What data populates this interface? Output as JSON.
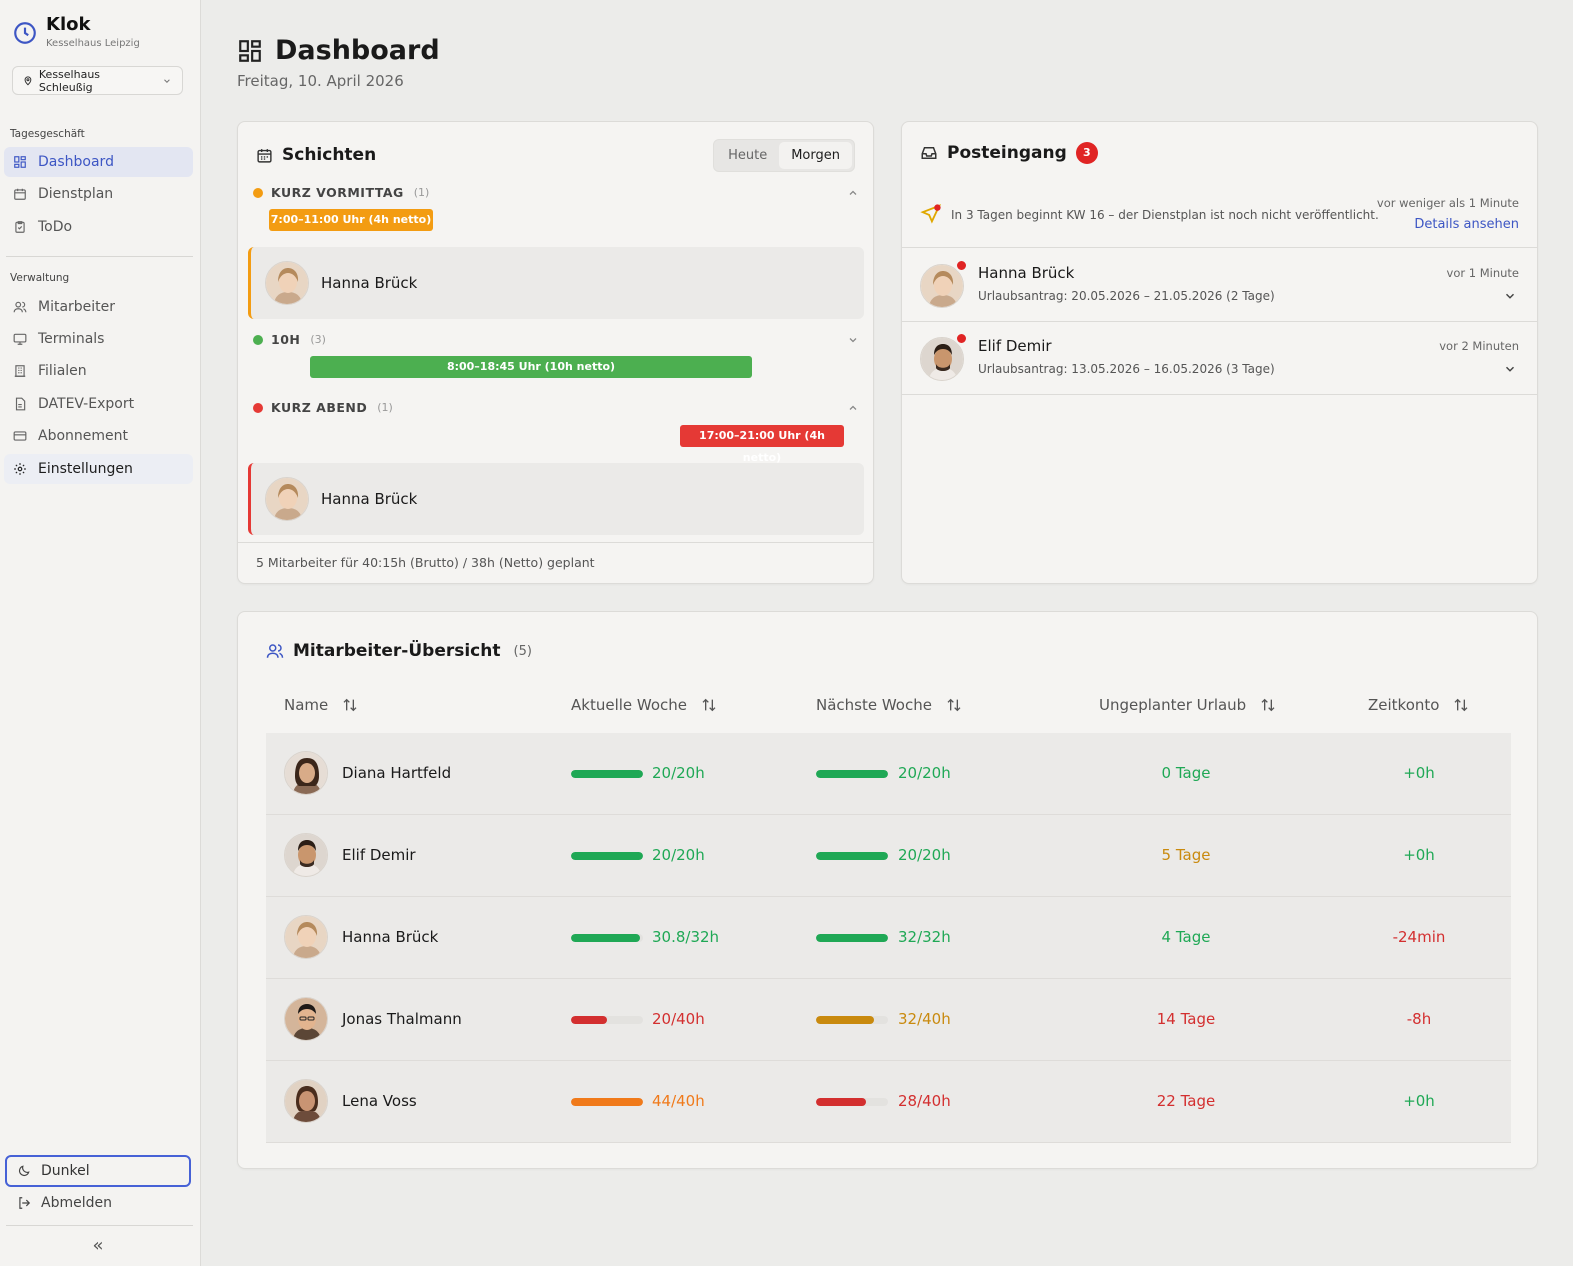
{
  "app": {
    "name": "Klok",
    "org": "Kesselhaus Leipzig"
  },
  "branch": {
    "selected": "Kesselhaus Schleußig"
  },
  "colors": {
    "accent": "#3d56c4",
    "green": "#1fa855",
    "orange": "#f39c12",
    "red": "#e53935",
    "amber": "#c98a0e"
  },
  "sidebar": {
    "section1": "Tagesgeschäft",
    "section2": "Verwaltung",
    "items": [
      {
        "label": "Dashboard",
        "icon": "dashboard-icon"
      },
      {
        "label": "Dienstplan",
        "icon": "calendar-icon"
      },
      {
        "label": "ToDo",
        "icon": "clipboard-icon"
      },
      {
        "label": "Mitarbeiter",
        "icon": "users-icon"
      },
      {
        "label": "Terminals",
        "icon": "monitor-icon"
      },
      {
        "label": "Filialen",
        "icon": "building-icon"
      },
      {
        "label": "DATEV-Export",
        "icon": "file-export-icon"
      },
      {
        "label": "Abonnement",
        "icon": "credit-card-icon"
      },
      {
        "label": "Einstellungen",
        "icon": "gear-icon"
      }
    ],
    "dark_mode": "Dunkel",
    "logout": "Abmelden",
    "collapse": "«"
  },
  "header": {
    "title": "Dashboard",
    "date": "Freitag, 10. April 2026"
  },
  "shifts": {
    "title": "Schichten",
    "tabs": [
      "Heute",
      "Morgen"
    ],
    "active_tab": "Morgen",
    "groups": [
      {
        "name": "KURZ VORMITTAG",
        "count": "(1)",
        "time": "7:00–11:00 Uhr (4h netto)",
        "color": "#f39c12",
        "employees": [
          "Hanna Brück"
        ]
      },
      {
        "name": "10H",
        "count": "(3)",
        "time": "8:00–18:45 Uhr (10h netto)",
        "color": "#4caf50",
        "employees": []
      },
      {
        "name": "KURZ ABEND",
        "count": "(1)",
        "time": "17:00–21:00 Uhr (4h netto)",
        "color": "#e53935",
        "employees": [
          "Hanna Brück"
        ]
      }
    ],
    "footer": "5 Mitarbeiter für 40:15h (Brutto) / 38h (Netto) geplant"
  },
  "inbox": {
    "title": "Posteingang",
    "count": "3",
    "system": {
      "text": "In 3 Tagen beginnt KW 16 – der Dienstplan ist noch nicht veröffentlicht.",
      "time": "vor weniger als 1 Minute",
      "link": "Details ansehen"
    },
    "messages": [
      {
        "name": "Hanna Brück",
        "text": "Urlaubsantrag: 20.05.2026 – 21.05.2026 (2 Tage)",
        "time": "vor 1 Minute"
      },
      {
        "name": "Elif Demir",
        "text": "Urlaubsantrag: 13.05.2026 – 16.05.2026 (3 Tage)",
        "time": "vor 2 Minuten"
      }
    ]
  },
  "overview": {
    "title": "Mitarbeiter-Übersicht",
    "count": "(5)",
    "columns": [
      "Name",
      "Aktuelle Woche",
      "Nächste Woche",
      "Ungeplanter Urlaub",
      "Zeitkonto"
    ],
    "rows": [
      {
        "name": "Diana Hartfeld",
        "cur": "20/20h",
        "cur_pct": 1.0,
        "cur_color": "#1fa855",
        "next": "20/20h",
        "next_pct": 1.0,
        "next_color": "#1fa855",
        "vacation": "0 Tage",
        "vac_color": "#1fa855",
        "account": "+0h",
        "acc_color": "#1fa855"
      },
      {
        "name": "Elif Demir",
        "cur": "20/20h",
        "cur_pct": 1.0,
        "cur_color": "#1fa855",
        "next": "20/20h",
        "next_pct": 1.0,
        "next_color": "#1fa855",
        "vacation": "5 Tage",
        "vac_color": "#c98a0e",
        "account": "+0h",
        "acc_color": "#1fa855"
      },
      {
        "name": "Hanna Brück",
        "cur": "30.8/32h",
        "cur_pct": 0.96,
        "cur_color": "#1fa855",
        "next": "32/32h",
        "next_pct": 1.0,
        "next_color": "#1fa855",
        "vacation": "4 Tage",
        "vac_color": "#1fa855",
        "account": "-24min",
        "acc_color": "#d32f2f"
      },
      {
        "name": "Jonas Thalmann",
        "cur": "20/40h",
        "cur_pct": 0.5,
        "cur_color": "#d32f2f",
        "next": "32/40h",
        "next_pct": 0.8,
        "next_color": "#c98a0e",
        "vacation": "14 Tage",
        "vac_color": "#d32f2f",
        "account": "-8h",
        "acc_color": "#d32f2f"
      },
      {
        "name": "Lena Voss",
        "cur": "44/40h",
        "cur_pct": 1.0,
        "cur_color": "#f07a1a",
        "next": "28/40h",
        "next_pct": 0.7,
        "next_color": "#d32f2f",
        "vacation": "22 Tage",
        "vac_color": "#d32f2f",
        "account": "+0h",
        "acc_color": "#1fa855"
      }
    ]
  }
}
